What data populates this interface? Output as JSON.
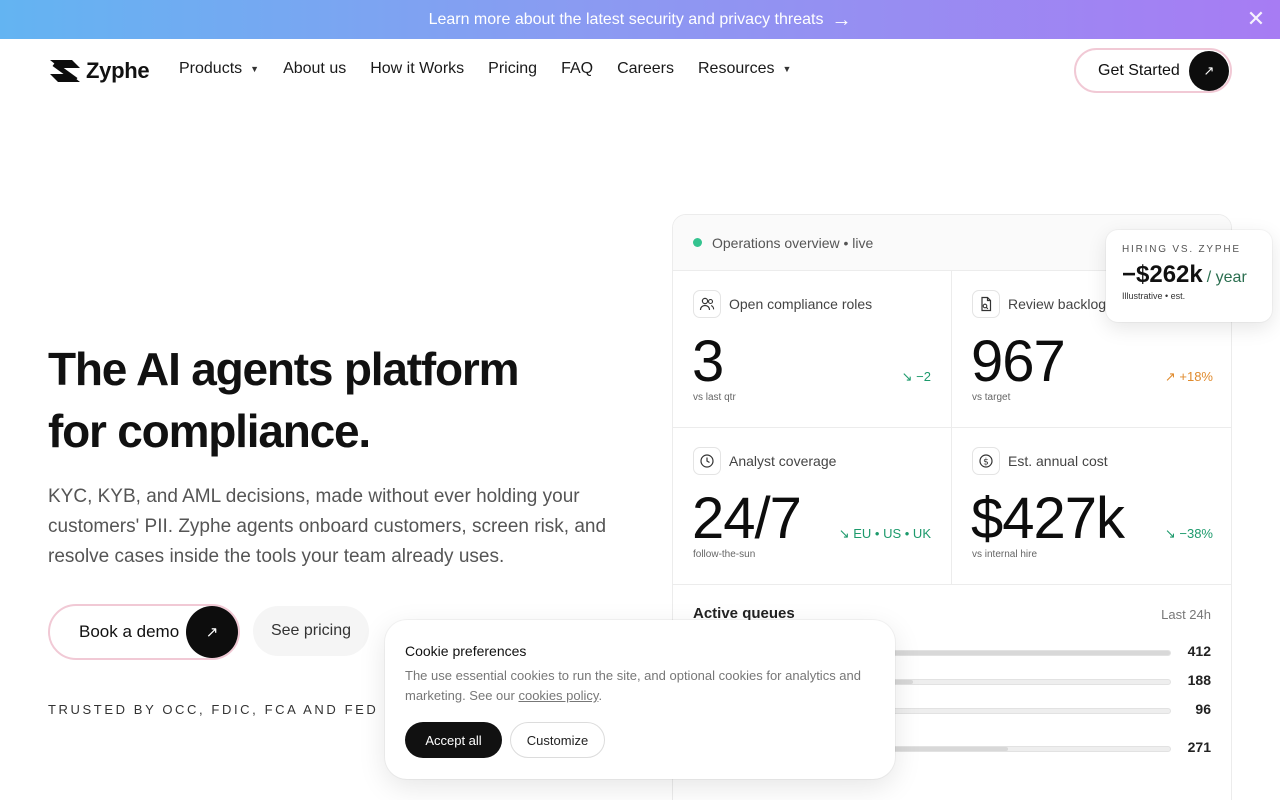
{
  "announcement": {
    "text": "Learn more about the latest security and privacy threats",
    "arrow": "→",
    "close": "✕"
  },
  "nav": {
    "brand": "Zyphe",
    "items": [
      {
        "label": "Products",
        "has_dropdown": true
      },
      {
        "label": "About us",
        "has_dropdown": false
      },
      {
        "label": "How it Works",
        "has_dropdown": false
      },
      {
        "label": "Pricing",
        "has_dropdown": false
      },
      {
        "label": "FAQ",
        "has_dropdown": false
      },
      {
        "label": "Careers",
        "has_dropdown": false
      },
      {
        "label": "Resources",
        "has_dropdown": true
      }
    ],
    "cta": "Get Started"
  },
  "hero": {
    "title_line1": "The AI agents platform",
    "title_line2": "for compliance.",
    "subtitle": "KYC, KYB, and AML decisions, made without ever holding your customers' PII. Zyphe agents onboard customers, screen risk, and resolve cases inside the tools your team already uses.",
    "primary_cta": "Book a demo",
    "secondary_cta": "See pricing",
    "trusted": "TRUSTED BY OCC, FDIC, FCA AND FED REG"
  },
  "dashboard": {
    "header": "Operations overview • live",
    "stats": [
      {
        "title": "Open compliance roles",
        "value": "3",
        "sub": "vs last qtr",
        "delta": "−2",
        "trend": "down",
        "icon": "users-icon"
      },
      {
        "title": "Review backlog",
        "value": "967",
        "sub": "vs target",
        "delta": "+18%",
        "trend": "up",
        "icon": "document-icon"
      },
      {
        "title": "Analyst coverage",
        "value": "24/7",
        "sub": "follow-the-sun",
        "delta": "EU • US • UK",
        "trend": "down",
        "icon": "clock-icon"
      },
      {
        "title": "Est. annual cost",
        "value": "$427k",
        "sub": "vs internal hire",
        "delta": "−38%",
        "trend": "down",
        "icon": "dollar-icon"
      }
    ],
    "queues_title": "Active queues",
    "queues_range": "Last 24h",
    "queues": [
      {
        "value": "412",
        "fill": 1.0
      },
      {
        "value": "188",
        "fill": 0.46
      },
      {
        "value": "96",
        "fill": 0.23
      },
      {
        "value": "271",
        "fill": 0.66
      }
    ]
  },
  "callout": {
    "label": "HIRING VS. ZYPHE",
    "value": "−$262k",
    "per": "/ year",
    "note": "Illustrative • est."
  },
  "cookie": {
    "title": "Cookie preferences",
    "body": "The use essential cookies to run the site, and optional cookies for analytics and marketing. See our",
    "link": "cookies policy",
    "accept": "Accept all",
    "customize": "Customize"
  },
  "colors": {
    "accent_green": "#34c38f",
    "delta_up": "#e08b2e",
    "delta_down": "#1d9a6c",
    "cta_border": "#f1c9d5"
  }
}
